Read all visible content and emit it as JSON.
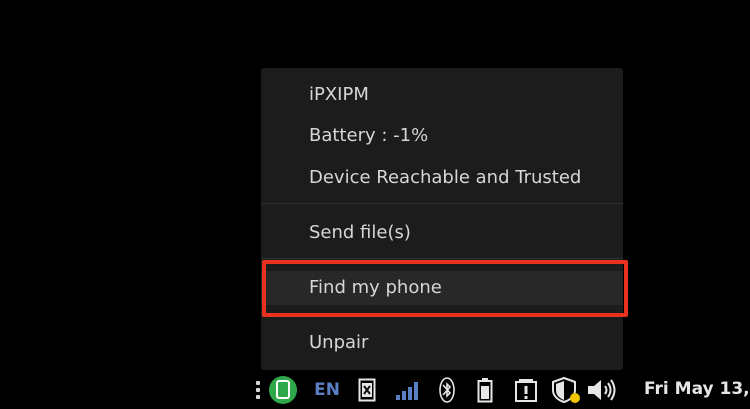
{
  "menu": {
    "items": [
      {
        "label": "iPXIPM"
      },
      {
        "label": "Battery : -1%"
      },
      {
        "label": "Device Reachable and Trusted"
      },
      {
        "label": "Send file(s)"
      },
      {
        "label": "Find my phone"
      },
      {
        "label": "Unpair"
      }
    ]
  },
  "panel": {
    "language": "EN",
    "clock": "Fri May 13,"
  },
  "colors": {
    "menu_bg": "#1c1c1c",
    "highlight_border": "#e8321f",
    "kdeconnect_green": "#2ea84a",
    "language_blue": "#5b7fc4"
  }
}
